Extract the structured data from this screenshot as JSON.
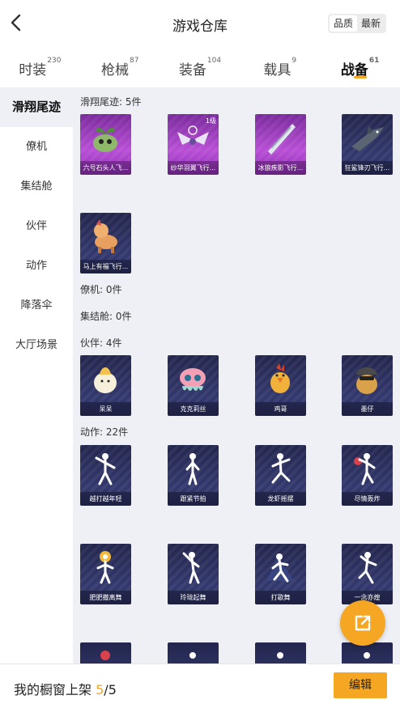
{
  "header": {
    "title": "游戏仓库",
    "sort_options": [
      "品质",
      "最新"
    ]
  },
  "tabs": [
    {
      "label": "时装",
      "count": "230"
    },
    {
      "label": "枪械",
      "count": "87"
    },
    {
      "label": "装备",
      "count": "104"
    },
    {
      "label": "载具",
      "count": "9"
    },
    {
      "label": "战备",
      "count": "61"
    }
  ],
  "sidebar": {
    "items": [
      "滑翔尾迹",
      "僚机",
      "集结舱",
      "伙伴",
      "动作",
      "降落伞",
      "大厅场景"
    ]
  },
  "sections": {
    "trails": {
      "label": "滑翔尾迹: 5件",
      "items": [
        {
          "name": "六号石头人飞..."
        },
        {
          "name": "纱华羽翼飞行...",
          "level": "1级"
        },
        {
          "name": "冰狼疾影飞行..."
        },
        {
          "name": "狂鲨锋刃飞行..."
        },
        {
          "name": "马上有福飞行..."
        }
      ]
    },
    "wingman": {
      "label": "僚机: 0件"
    },
    "pod": {
      "label": "集结舱: 0件"
    },
    "partners": {
      "label": "伙伴: 4件",
      "items": [
        {
          "name": "呆呆"
        },
        {
          "name": "克克莉丝"
        },
        {
          "name": "鸡哥"
        },
        {
          "name": "墨仔"
        }
      ]
    },
    "emotes": {
      "label": "动作: 22件",
      "items": [
        {
          "name": "越打越年轻"
        },
        {
          "name": "跟紧节拍"
        },
        {
          "name": "龙虾摇摆"
        },
        {
          "name": "尽情轰炸"
        },
        {
          "name": "肥肥撒离舞"
        },
        {
          "name": "玲珑起舞"
        },
        {
          "name": "打歌舞"
        },
        {
          "name": "一念亦煌"
        }
      ]
    }
  },
  "bottom": {
    "showcase_label": "我的橱窗上架",
    "current": "5",
    "total": "/5",
    "edit_label": "编辑"
  },
  "colors": {
    "accent": "#f5a623",
    "legendary": "#b84fd6",
    "epic": "#33396e"
  }
}
